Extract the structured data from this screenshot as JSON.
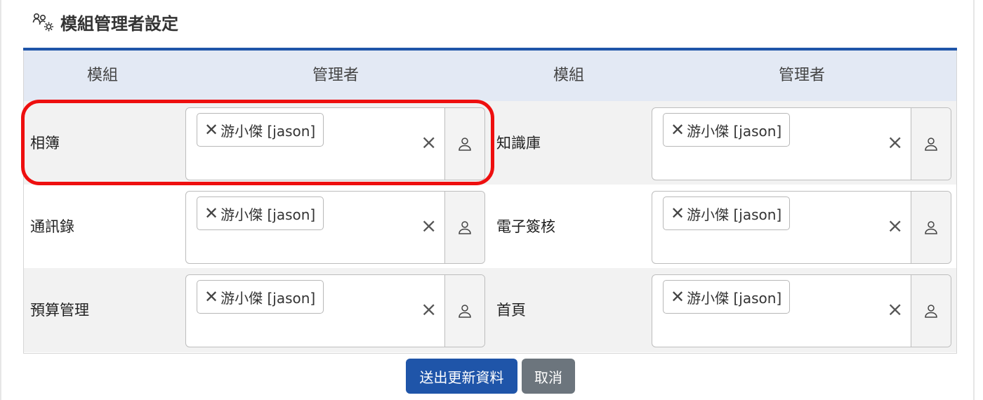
{
  "page": {
    "title": "模組管理者設定"
  },
  "table": {
    "headers": [
      "模組",
      "管理者",
      "模組",
      "管理者"
    ],
    "rows": [
      {
        "shade": true,
        "cells": [
          {
            "module": "相簿",
            "manager_chip": "游小傑 [jason]"
          },
          {
            "module": "知識庫",
            "manager_chip": "游小傑 [jason]"
          }
        ]
      },
      {
        "shade": false,
        "cells": [
          {
            "module": "通訊錄",
            "manager_chip": "游小傑 [jason]"
          },
          {
            "module": "電子簽核",
            "manager_chip": "游小傑 [jason]"
          }
        ]
      },
      {
        "shade": true,
        "cells": [
          {
            "module": "預算管理",
            "manager_chip": "游小傑 [jason]"
          },
          {
            "module": "首頁",
            "manager_chip": "游小傑 [jason]"
          }
        ]
      }
    ],
    "chip_remove_glyph": "✕",
    "clear_glyph": "×"
  },
  "actions": {
    "submit_label": "送出更新資料",
    "cancel_label": "取消"
  },
  "colors": {
    "primary": "#1f55a9",
    "header_bg": "#e3e9f4",
    "row_shade": "#f2f2f2",
    "highlight": "#ee0f0f",
    "cancel": "#6c757d"
  },
  "icons": {
    "title_icon": "users-gear-icon",
    "picker_button_icon": "user-icon",
    "chip_remove_icon": "close-icon",
    "clear_icon": "clear-icon"
  }
}
